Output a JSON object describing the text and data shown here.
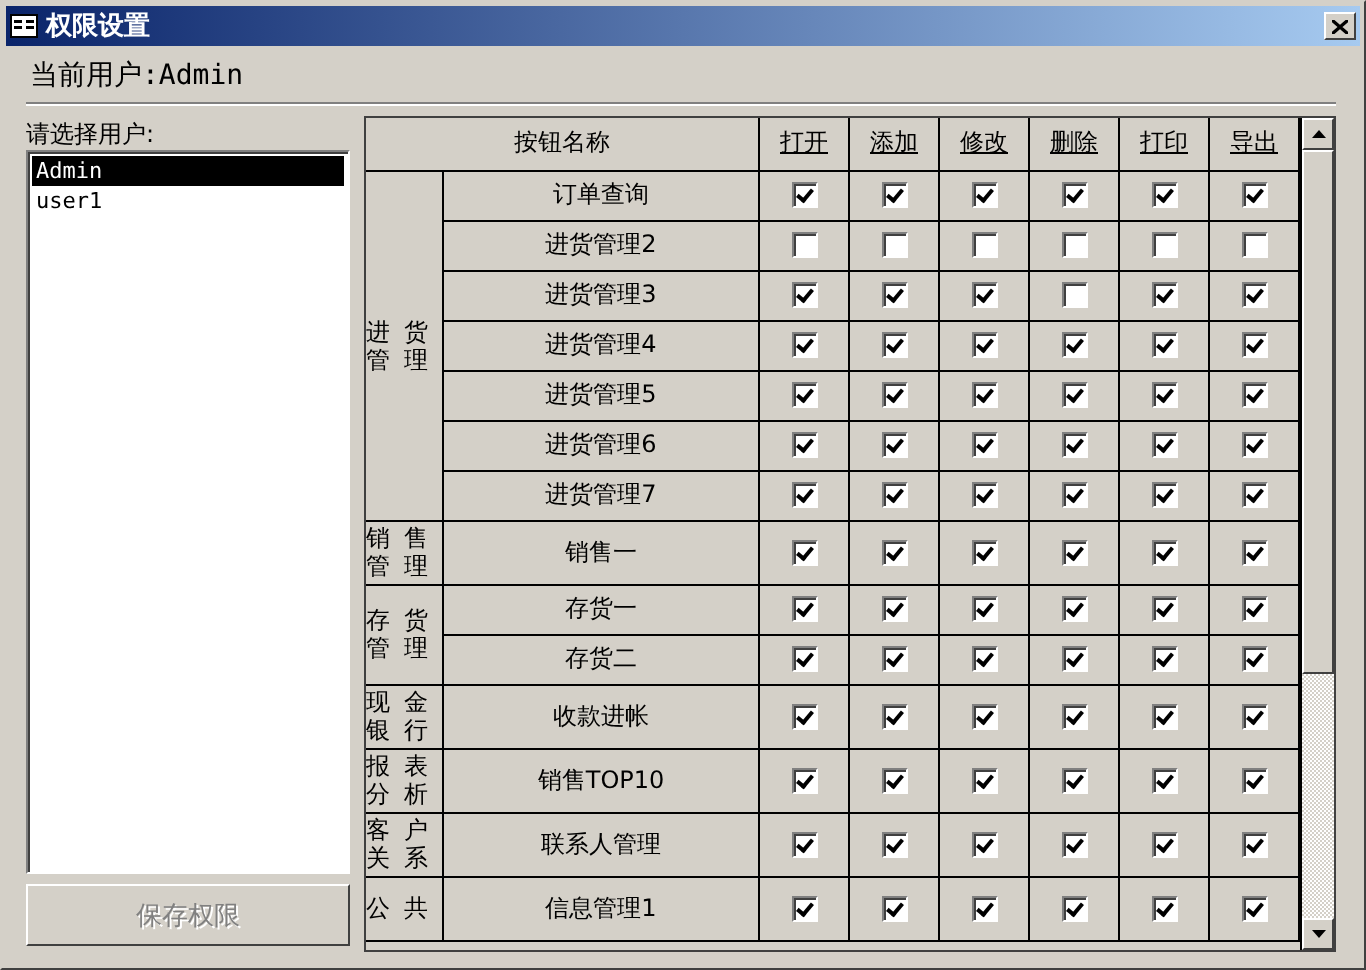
{
  "window": {
    "title": "权限设置"
  },
  "current_user": "当前用户:Admin",
  "user_list": {
    "label": "请选择用户:",
    "items": [
      {
        "name": "Admin",
        "selected": true
      },
      {
        "name": "user1",
        "selected": false
      }
    ]
  },
  "save_button": {
    "label": "保存权限",
    "disabled": true
  },
  "table": {
    "columns": [
      "按钮名称",
      "打开",
      "添加",
      "修改",
      "删除",
      "打印",
      "导出"
    ],
    "groups": [
      {
        "name": "进货管理",
        "rows": [
          {
            "name": "订单查询",
            "permissions": [
              true,
              true,
              true,
              true,
              true,
              true
            ]
          },
          {
            "name": "进货管理2",
            "permissions": [
              false,
              false,
              false,
              false,
              false,
              false
            ]
          },
          {
            "name": "进货管理3",
            "permissions": [
              true,
              true,
              true,
              false,
              true,
              true
            ]
          },
          {
            "name": "进货管理4",
            "permissions": [
              true,
              true,
              true,
              true,
              true,
              true
            ]
          },
          {
            "name": "进货管理5",
            "permissions": [
              true,
              true,
              true,
              true,
              true,
              true
            ]
          },
          {
            "name": "进货管理6",
            "permissions": [
              true,
              true,
              true,
              true,
              true,
              true
            ]
          },
          {
            "name": "进货管理7",
            "permissions": [
              true,
              true,
              true,
              true,
              true,
              true
            ]
          }
        ]
      },
      {
        "name": "销售管理",
        "rows": [
          {
            "name": "销售一",
            "permissions": [
              true,
              true,
              true,
              true,
              true,
              true
            ]
          }
        ]
      },
      {
        "name": "存货管理",
        "rows": [
          {
            "name": "存货一",
            "permissions": [
              true,
              true,
              true,
              true,
              true,
              true
            ]
          },
          {
            "name": "存货二",
            "permissions": [
              true,
              true,
              true,
              true,
              true,
              true
            ]
          }
        ]
      },
      {
        "name": "现金银行",
        "rows": [
          {
            "name": "收款进帐",
            "permissions": [
              true,
              true,
              true,
              true,
              true,
              true
            ]
          }
        ]
      },
      {
        "name": "报表分析",
        "rows": [
          {
            "name": "销售TOP10",
            "permissions": [
              true,
              true,
              true,
              true,
              true,
              true
            ]
          }
        ]
      },
      {
        "name": "客户关系",
        "rows": [
          {
            "name": "联系人管理",
            "permissions": [
              true,
              true,
              true,
              true,
              true,
              true
            ]
          }
        ]
      },
      {
        "name": "公共",
        "rows": [
          {
            "name": "信息管理1",
            "permissions": [
              true,
              true,
              true,
              true,
              true,
              true
            ]
          }
        ]
      }
    ]
  }
}
